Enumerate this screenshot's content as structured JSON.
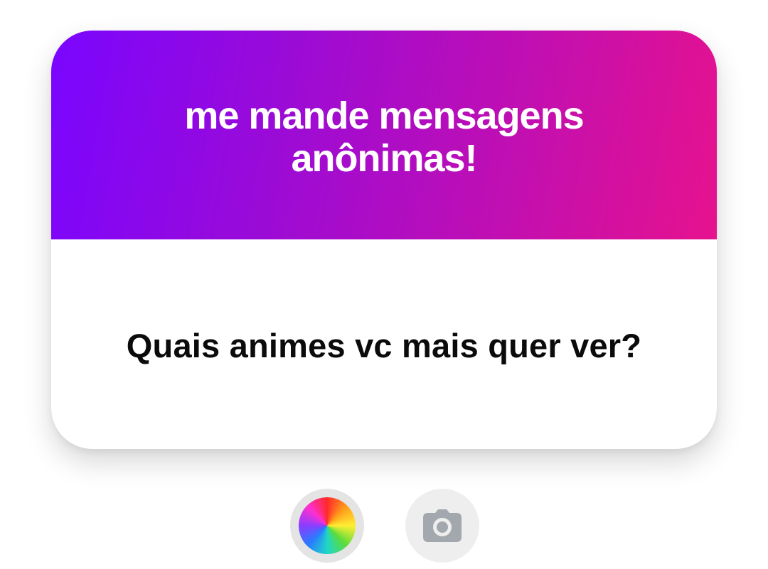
{
  "card": {
    "title": "me mande mensagens anônimas!",
    "question": "Quais animes vc mais quer ver?"
  },
  "controls": {
    "color_icon": "color-wheel-icon",
    "camera_icon": "camera-icon"
  },
  "colors": {
    "gradient_start": "#7a05ff",
    "gradient_end": "#e6128e",
    "question_text": "#0b0b0b",
    "camera_icon": "#a3a8ae"
  }
}
